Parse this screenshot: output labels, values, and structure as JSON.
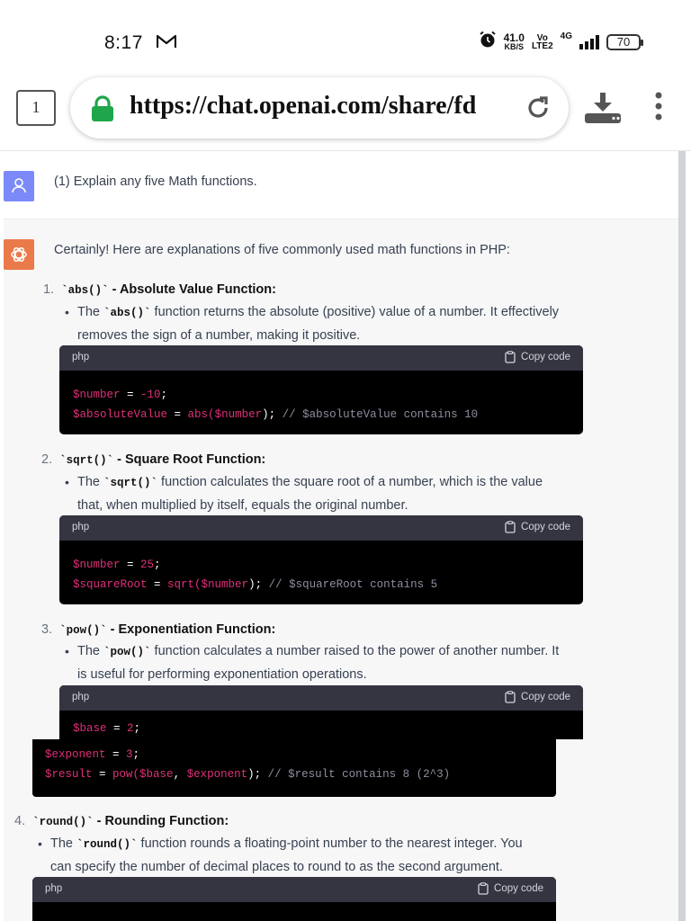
{
  "status_bar": {
    "time": "8:17",
    "speed_value": "41.0",
    "speed_unit": "KB/S",
    "volte_top": "Vo",
    "volte_bottom": "LTE2",
    "network": "4G",
    "battery": "70"
  },
  "browser": {
    "tab_count": "1",
    "url": "https://chat.openai.com/share/fd"
  },
  "chat": {
    "user_message": "(1) Explain any five Math functions.",
    "intro": "Certainly! Here are explanations of five commonly used math functions in PHP:",
    "copy_label": "Copy code",
    "items": [
      {
        "num": "1.",
        "code": "`abs()`",
        "title": " - Absolute Value Function:",
        "bullet_pre": "The ",
        "bullet_code": "`abs()`",
        "bullet_line1": " function returns the absolute (positive) value of a number. It effectively",
        "bullet_line2": "removes the sign of a number, making it positive.",
        "lang": "php"
      },
      {
        "num": "2.",
        "code": "`sqrt()`",
        "title": " - Square Root Function:",
        "bullet_pre": "The ",
        "bullet_code": "`sqrt()`",
        "bullet_line1": " function calculates the square root of a number, which is the value",
        "bullet_line2": "that, when multiplied by itself, equals the original number.",
        "lang": "php"
      },
      {
        "num": "3.",
        "code": "`pow()`",
        "title": " - Exponentiation Function:",
        "bullet_pre": "The ",
        "bullet_code": "`pow()`",
        "bullet_line1": " function calculates a number raised to the power of another number. It",
        "bullet_line2": "is useful for performing exponentiation operations.",
        "lang": "php"
      },
      {
        "num": "4.",
        "code": "`round()`",
        "title": " - Rounding Function:",
        "bullet_pre": "The ",
        "bullet_code": "`round()`",
        "bullet_line1": " function rounds a floating-point number to the nearest integer. You",
        "bullet_line2": "can specify the number of decimal places to round to as the second argument.",
        "lang": "php"
      }
    ],
    "code1": {
      "l1_var": "$number",
      "l1_op": " = ",
      "l1_val": "-10",
      "l1_end": ";",
      "l2_var": "$absoluteValue",
      "l2_op": " = ",
      "l2_fn": "abs(",
      "l2_arg": "$number",
      "l2_close": ");",
      "l2_comment": " // $absoluteValue contains 10"
    },
    "code2": {
      "l1_var": "$number",
      "l1_op": " = ",
      "l1_val": "25",
      "l1_end": ";",
      "l2_var": "$squareRoot",
      "l2_op": " = ",
      "l2_fn": "sqrt(",
      "l2_arg": "$number",
      "l2_close": ");",
      "l2_comment": " // $squareRoot contains 5"
    },
    "code3": {
      "l1_var": "$base",
      "l1_op": " = ",
      "l1_val": "2",
      "l1_end": ";",
      "l2_var": "$exponent",
      "l2_op": " = ",
      "l2_val": "3",
      "l2_end": ";",
      "l3_var": "$result",
      "l3_op": " = ",
      "l3_fn": "pow(",
      "l3_arg1": "$base",
      "l3_sep": ", ",
      "l3_arg2": "$exponent",
      "l3_close": ");",
      "l3_comment": " // $result contains 8 (2^3)"
    }
  },
  "colors": {
    "user_avatar": "#7b8af8",
    "bot_avatar": "#ea7a4a",
    "lock_green": "#1fa64a",
    "code_red": "#df3079"
  }
}
